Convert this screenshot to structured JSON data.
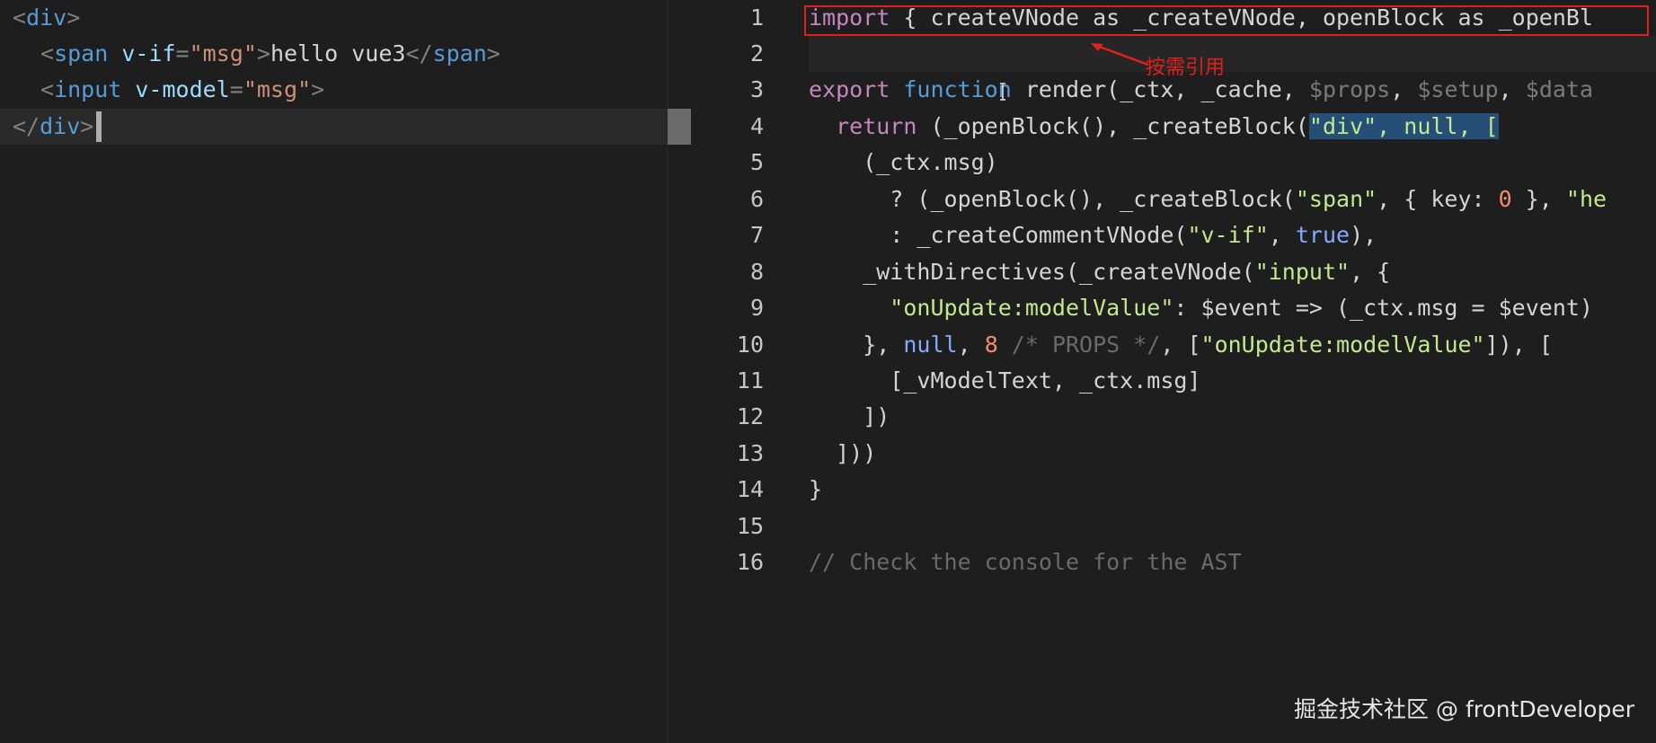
{
  "left_editor": {
    "lines": [
      {
        "parts": [
          "<",
          "div",
          ">"
        ]
      },
      {
        "parts": [
          "<",
          "span",
          " v-if",
          "=",
          "\"msg\"",
          ">",
          "hello vue3",
          "</",
          "span",
          ">"
        ]
      },
      {
        "parts": [
          "<",
          "input",
          " v-model",
          "=",
          "\"msg\"",
          ">"
        ]
      },
      {
        "parts": [
          "</",
          "div",
          ">"
        ]
      }
    ]
  },
  "right_editor": {
    "line_numbers": [
      "1",
      "2",
      "3",
      "4",
      "5",
      "6",
      "7",
      "8",
      "9",
      "10",
      "11",
      "12",
      "13",
      "14",
      "15",
      "16"
    ],
    "l1": {
      "kw": "import",
      "rest": " { createVNode as _createVNode, openBlock as _openBl"
    },
    "l3": {
      "kw": "export",
      "fn": " function",
      "rest": " render(_ctx, _cache, ",
      "p1": "$props",
      "c1": ", ",
      "p2": "$setup",
      "c2": ", ",
      "p3": "$data"
    },
    "l4": {
      "kw": "  return",
      "rest": " (_openBlock(), _createBlock(",
      "sel": "\"div\", null, ["
    },
    "l5": "    (_ctx.msg)",
    "l6": {
      "a": "      ? (_openBlock(), _createBlock(",
      "s1": "\"span\"",
      "b": ", { key: ",
      "n": "0",
      "c": " }, ",
      "s2": "\"he"
    },
    "l7": {
      "a": "      : _createCommentVNode(",
      "s1": "\"v-if\"",
      "b": ", ",
      "t": "true",
      "c": "),"
    },
    "l8": {
      "a": "    _withDirectives(_createVNode(",
      "s1": "\"input\"",
      "b": ", {"
    },
    "l9": {
      "s1": "      \"onUpdate:modelValue\"",
      "b": ": $event => (_ctx.msg = $event)"
    },
    "l10": {
      "a": "    }, ",
      "nl": "null",
      "b": ", ",
      "n": "8",
      "cm": " /* PROPS */",
      "c": ", [",
      "s1": "\"onUpdate:modelValue\"",
      "d": "]), ["
    },
    "l11": "      [_vModelText, _ctx.msg]",
    "l12": "    ])",
    "l13": "  ]))",
    "l14": "}",
    "l16": "// Check the console for the AST"
  },
  "annotation": {
    "label": "按需引用",
    "color": "#e0201a"
  },
  "watermark": "掘金技术社区 @ frontDeveloper"
}
